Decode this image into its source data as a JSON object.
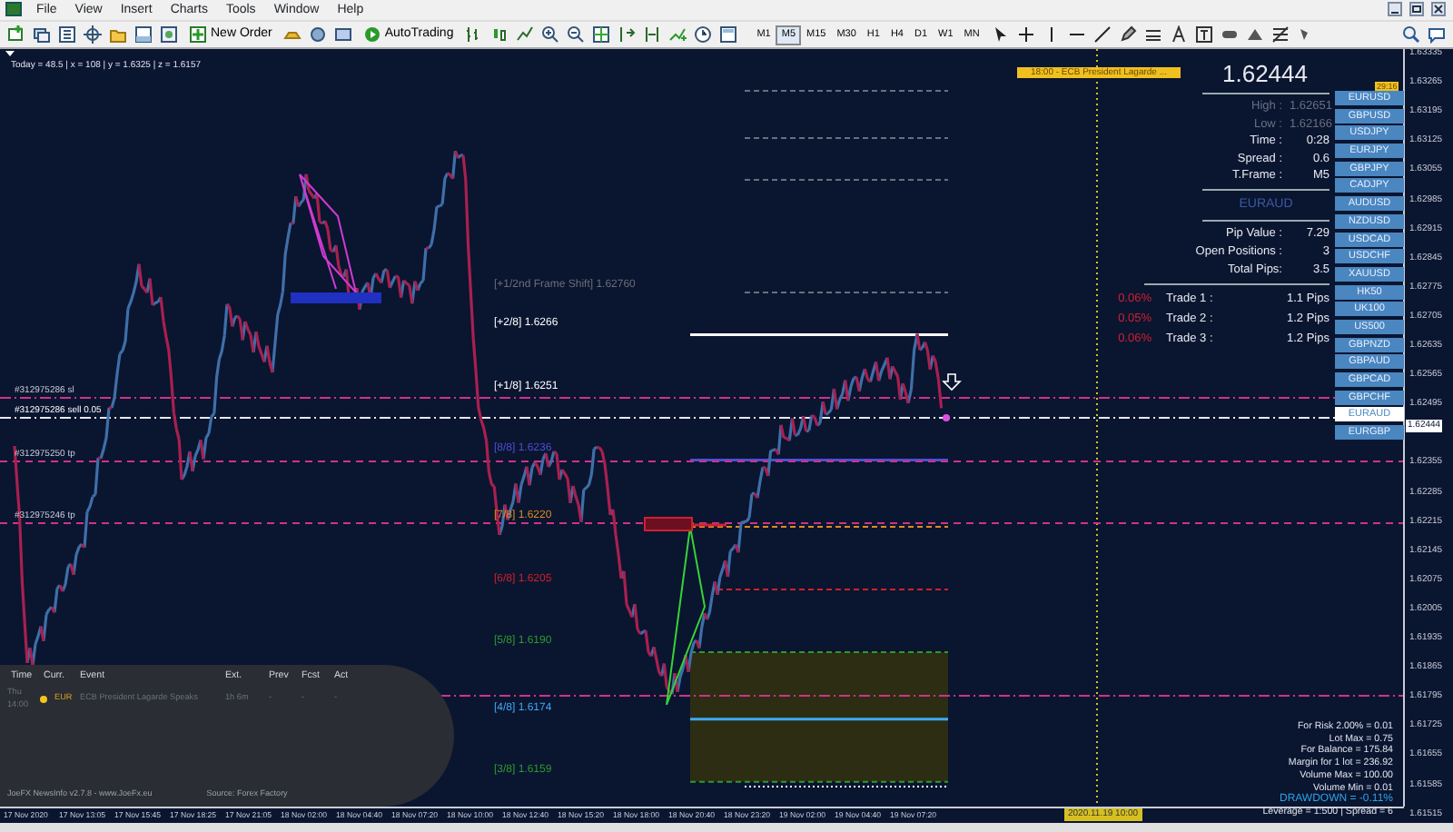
{
  "menu": [
    "File",
    "View",
    "Insert",
    "Charts",
    "Tools",
    "Window",
    "Help"
  ],
  "toolbar": {
    "buttons": [
      {
        "label": "New Order",
        "kind": "order"
      },
      {
        "label": "AutoTrading",
        "kind": "auto"
      }
    ],
    "timeframes": [
      {
        "label": "M1",
        "selected": false
      },
      {
        "label": "M5",
        "selected": true
      },
      {
        "label": "M15",
        "selected": false
      },
      {
        "label": "M30",
        "selected": false
      },
      {
        "label": "H1",
        "selected": false
      },
      {
        "label": "H4",
        "selected": false
      },
      {
        "label": "D1",
        "selected": false
      },
      {
        "label": "W1",
        "selected": false
      },
      {
        "label": "MN",
        "selected": false
      }
    ]
  },
  "chart": {
    "info": "Today = 48.5  |  x = 108  |  y = 1.6325  |  z = 1.6157",
    "news_marker": "18:00 - ECB President Lagarde ...",
    "countdown": "29:16",
    "time_marker": "2020.11.19 10:00",
    "price_axis": [
      "1.63335",
      "1.63265",
      "1.63195",
      "1.63125",
      "1.63055",
      "1.62985",
      "1.62915",
      "1.62845",
      "1.62775",
      "1.62705",
      "1.62635",
      "1.62565",
      "1.62495",
      "1.62355",
      "1.62285",
      "1.62215",
      "1.62145",
      "1.62075",
      "1.62005",
      "1.61935",
      "1.61865",
      "1.61795",
      "1.61725",
      "1.61655",
      "1.61585",
      "1.61515"
    ],
    "current_price": "1.62444",
    "time_axis": [
      "17 Nov 2020",
      "17 Nov 13:05",
      "17 Nov 15:45",
      "17 Nov 18:25",
      "17 Nov 21:05",
      "18 Nov 02:00",
      "18 Nov 04:40",
      "18 Nov 07:20",
      "18 Nov 10:00",
      "18 Nov 12:40",
      "18 Nov 15:20",
      "18 Nov 18:00",
      "18 Nov 20:40",
      "18 Nov 23:20",
      "19 Nov 02:00",
      "19 Nov 04:40",
      "19 Nov 07:20"
    ],
    "order_lines": [
      {
        "label": "#312975286 sl",
        "kind": "sl"
      },
      {
        "label": "#312975286 sell 0.05",
        "kind": "entry"
      },
      {
        "label": "#312975250 tp",
        "kind": "tp"
      },
      {
        "label": "#312975246 tp",
        "kind": "tp"
      }
    ],
    "murrey_levels": [
      {
        "label": "[+1/2nd Frame Shift]",
        "price": "1.62760",
        "color": "#6b6f7a"
      },
      {
        "label": "[+2/8]",
        "price": "1.6266",
        "color": "#ffffff"
      },
      {
        "label": "[+1/8]",
        "price": "1.6251",
        "color": "#ffffff"
      },
      {
        "label": "[8/8]",
        "price": "1.6236",
        "color": "#4f4fd0"
      },
      {
        "label": "[7/8]",
        "price": "1.6220",
        "color": "#e08a1e"
      },
      {
        "label": "[6/8]",
        "price": "1.6205",
        "color": "#d0202a"
      },
      {
        "label": "[5/8]",
        "price": "1.6190",
        "color": "#2e9a2e"
      },
      {
        "label": "[4/8]",
        "price": "1.6174",
        "color": "#3fa9f5"
      },
      {
        "label": "[3/8]",
        "price": "1.6159",
        "color": "#2e9a2e"
      }
    ]
  },
  "info_panel": {
    "price": "1.62444",
    "rows": [
      {
        "label": "High :",
        "value": "1.62651",
        "dim": true
      },
      {
        "label": "Low :",
        "value": "1.62166",
        "dim": true
      },
      {
        "label": "Time :",
        "value": "0:28",
        "dim": false
      },
      {
        "label": "Spread :",
        "value": "0.6",
        "dim": false
      },
      {
        "label": "T.Frame :",
        "value": "M5",
        "dim": false
      }
    ],
    "symbol": "EURAUD",
    "stats": [
      {
        "label": "Pip Value :",
        "value": "7.29"
      },
      {
        "label": "Open Positions :",
        "value": "3"
      },
      {
        "label": "Total Pips:",
        "value": "3.5"
      }
    ],
    "trades": [
      {
        "percent": "0.06%",
        "label": "Trade 1 :",
        "value": "1.1 Pips"
      },
      {
        "percent": "0.05%",
        "label": "Trade 2 :",
        "value": "1.2 Pips"
      },
      {
        "percent": "0.06%",
        "label": "Trade 3 :",
        "value": "1.2 Pips"
      }
    ]
  },
  "symbols": [
    {
      "label": "EURUSD",
      "selected": false
    },
    {
      "label": "GBPUSD",
      "selected": false
    },
    {
      "label": "USDJPY",
      "selected": false
    },
    {
      "label": "EURJPY",
      "selected": false
    },
    {
      "label": "GBPJPY",
      "selected": false
    },
    {
      "label": "CADJPY",
      "selected": false
    },
    {
      "label": "AUDUSD",
      "selected": false
    },
    {
      "label": "NZDUSD",
      "selected": false
    },
    {
      "label": "USDCAD",
      "selected": false
    },
    {
      "label": "USDCHF",
      "selected": false
    },
    {
      "label": "XAUUSD",
      "selected": false
    },
    {
      "label": "HK50",
      "selected": false
    },
    {
      "label": "UK100",
      "selected": false
    },
    {
      "label": "US500",
      "selected": false
    },
    {
      "label": "GBPNZD",
      "selected": false
    },
    {
      "label": "GBPAUD",
      "selected": false
    },
    {
      "label": "GBPCAD",
      "selected": false
    },
    {
      "label": "GBPCHF",
      "selected": false
    },
    {
      "label": "EURAUD",
      "selected": true
    },
    {
      "label": "EURGBP",
      "selected": false
    }
  ],
  "news_panel": {
    "columns": [
      "Time",
      "Curr.",
      "Event",
      "Ext.",
      "Prev",
      "Fcst",
      "Act"
    ],
    "rows": [
      {
        "time": "Thu 14:00",
        "currency": "EUR",
        "color": "#f5c518",
        "event": "ECB President Lagarde Speaks",
        "ext": "1h 6m",
        "prev": "-",
        "fcst": "-",
        "act": "-"
      }
    ],
    "footer": "JoeFX NewsInfo v2.7.8  -  www.JoeFx.eu",
    "source": "Source: Forex Factory"
  },
  "risk_panel": [
    {
      "text": "For Risk 2.00% = 0.01",
      "kind": "normal"
    },
    {
      "text": "Lot Max = 0.75",
      "kind": "normal"
    },
    {
      "text": "For Balance = 175.84",
      "kind": "normal"
    },
    {
      "text": "Margin for 1 lot = 236.92",
      "kind": "normal"
    },
    {
      "text": "Volume Max = 100.00",
      "kind": "normal"
    },
    {
      "text": "Volume Min = 0.01",
      "kind": "normal"
    },
    {
      "text": "DRAWDOWN = -0.11%",
      "kind": "highlight"
    },
    {
      "text": "Leverage = 1:500 | Spread = 6",
      "kind": "normal"
    }
  ]
}
